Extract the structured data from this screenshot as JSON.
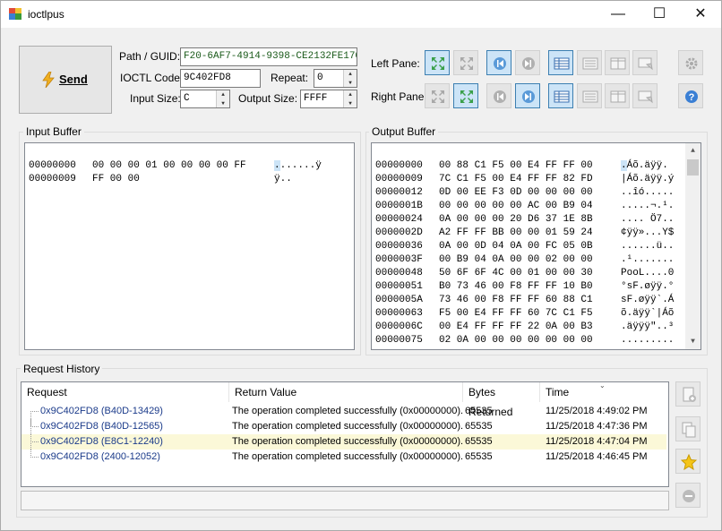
{
  "window": {
    "title": "ioctlpus"
  },
  "toolbar": {
    "send_label": "Send",
    "path_label": "Path / GUID:",
    "path_value": "F20-6AF7-4914-9398-CE2132FE170F}",
    "ioctl_label": "IOCTL Code:",
    "ioctl_value": "9C402FD8",
    "repeat_label": "Repeat:",
    "repeat_value": "0",
    "input_size_label": "Input Size:",
    "input_size_value": "C",
    "output_size_label": "Output Size:",
    "output_size_value": "FFFF",
    "left_pane_label": "Left Pane:",
    "right_pane_label": "Right Pane:"
  },
  "input_buffer": {
    "title": "Input Buffer",
    "rows": [
      {
        "addr": "00000000",
        "hex": "00 00 00 01 00 00 00 00 FF",
        "ascii": ".......ÿ"
      },
      {
        "addr": "00000009",
        "hex": "FF 00 00",
        "ascii": "ÿ.."
      }
    ]
  },
  "output_buffer": {
    "title": "Output Buffer",
    "rows": [
      {
        "addr": "00000000",
        "hex": "00 88 C1 F5 00 E4 FF FF 00",
        "ascii": ".Áõ.äÿÿ."
      },
      {
        "addr": "00000009",
        "hex": "7C C1 F5 00 E4 FF FF 82 FD",
        "ascii": "|Áõ.äÿÿ.ý"
      },
      {
        "addr": "00000012",
        "hex": "0D 00 EE F3 0D 00 00 00 00",
        "ascii": "..îó....."
      },
      {
        "addr": "0000001B",
        "hex": "00 00 00 00 00 AC 00 B9 04",
        "ascii": ".....¬.¹."
      },
      {
        "addr": "00000024",
        "hex": "0A 00 00 00 20 D6 37 1E 8B",
        "ascii": ".... Ö7.."
      },
      {
        "addr": "0000002D",
        "hex": "A2 FF FF BB 00 00 01 59 24",
        "ascii": "¢ÿÿ»...Y$"
      },
      {
        "addr": "00000036",
        "hex": "0A 00 0D 04 0A 00 FC 05 0B",
        "ascii": "......ü.."
      },
      {
        "addr": "0000003F",
        "hex": "00 B9 04 0A 00 00 02 00 00",
        "ascii": ".¹......."
      },
      {
        "addr": "00000048",
        "hex": "50 6F 6F 4C 00 01 00 00 30",
        "ascii": "PooL....0"
      },
      {
        "addr": "00000051",
        "hex": "B0 73 46 00 F8 FF FF 10 B0",
        "ascii": "°sF.øÿÿ.°"
      },
      {
        "addr": "0000005A",
        "hex": "73 46 00 F8 FF FF 60 88 C1",
        "ascii": "sF.øÿÿ`.Á"
      },
      {
        "addr": "00000063",
        "hex": "F5 00 E4 FF FF 60 7C C1 F5",
        "ascii": "õ.äÿÿ`|Áõ"
      },
      {
        "addr": "0000006C",
        "hex": "00 E4 FF FF FF 22 0A 00 B3",
        "ascii": ".äÿÿÿ\"..³"
      },
      {
        "addr": "00000075",
        "hex": "02 0A 00 00 00 00 00 00 00",
        "ascii": "........."
      }
    ]
  },
  "history": {
    "title": "Request History",
    "columns": [
      "Request",
      "Return Value",
      "Bytes Returned",
      "Time"
    ],
    "rows": [
      {
        "request": "0x9C402FD8 (B40D-13429)",
        "ret": "The operation completed successfully (0x00000000).",
        "bytes": "65535",
        "time": "11/25/2018 4:49:02 PM"
      },
      {
        "request": "0x9C402FD8 (B40D-12565)",
        "ret": "The operation completed successfully (0x00000000).",
        "bytes": "65535",
        "time": "11/25/2018 4:47:36 PM"
      },
      {
        "request": "0x9C402FD8 (E8C1-12240)",
        "ret": "The operation completed successfully (0x00000000).",
        "bytes": "65535",
        "time": "11/25/2018 4:47:04 PM"
      },
      {
        "request": "0x9C402FD8 (2400-12052)",
        "ret": "The operation completed successfully (0x00000000).",
        "bytes": "65535",
        "time": "11/25/2018 4:46:45 PM"
      }
    ],
    "highlighted_row": 2
  },
  "colors": {
    "accent": "#3c7fb1",
    "selected_bg": "#cce4f7",
    "highlight_row": "#fbf8d8",
    "path_text": "#1a5a1a"
  }
}
